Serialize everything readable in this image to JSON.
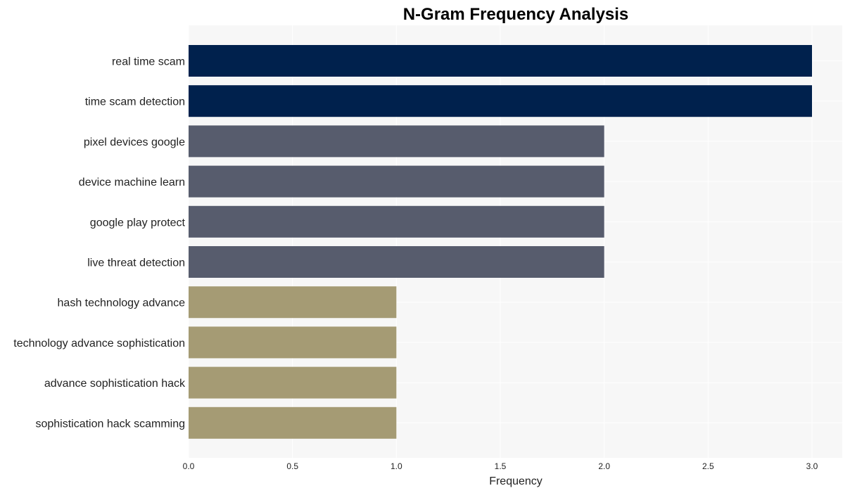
{
  "chart_data": {
    "type": "bar",
    "orientation": "horizontal",
    "title": "N-Gram Frequency Analysis",
    "xlabel": "Frequency",
    "ylabel": "",
    "xlim": [
      0,
      3.15
    ],
    "xticks": [
      0.0,
      0.5,
      1.0,
      1.5,
      2.0,
      2.5,
      3.0
    ],
    "xtick_labels": [
      "0.0",
      "0.5",
      "1.0",
      "1.5",
      "2.0",
      "2.5",
      "3.0"
    ],
    "grid": true,
    "categories": [
      "real time scam",
      "time scam detection",
      "pixel devices google",
      "device machine learn",
      "google play protect",
      "live threat detection",
      "hash technology advance",
      "technology advance sophistication",
      "advance sophistication hack",
      "sophistication hack scamming"
    ],
    "values": [
      3,
      3,
      2,
      2,
      2,
      2,
      1,
      1,
      1,
      1
    ],
    "colors": [
      "#00214d",
      "#00214d",
      "#575c6d",
      "#575c6d",
      "#575c6d",
      "#575c6d",
      "#a59b74",
      "#a59b74",
      "#a59b74",
      "#a59b74"
    ],
    "background": "#f7f7f7"
  }
}
